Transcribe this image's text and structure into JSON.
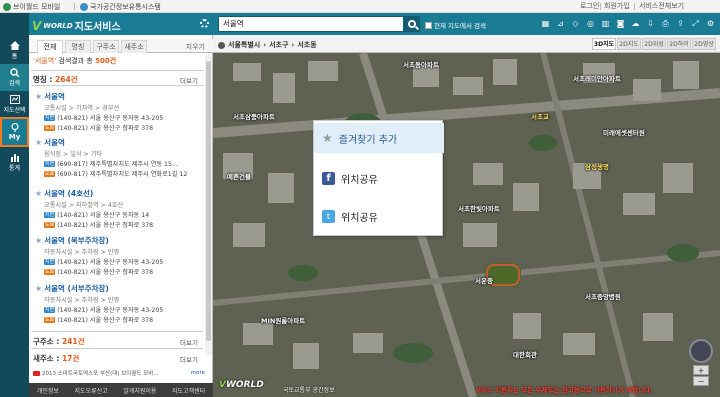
{
  "topbar": {
    "links_left": [
      "브이월드 모바일",
      "국가공간정보유통시스템"
    ],
    "links_right": [
      "로그인",
      "회원가입",
      "서비스전체보기"
    ]
  },
  "leftnav": {
    "items": [
      {
        "label": "홈",
        "icon": "home-icon"
      },
      {
        "label": "검색",
        "icon": "search-icon"
      },
      {
        "label": "지도선택",
        "icon": "map-select-icon"
      },
      {
        "label": "My",
        "icon": "pin-icon"
      },
      {
        "label": "통계",
        "icon": "stats-icon"
      }
    ]
  },
  "panel": {
    "title": "지도서비스",
    "tabs": [
      "전체",
      "명칭",
      "구주소",
      "새주소"
    ],
    "clear_label": "지우기",
    "summary": {
      "keyword": "'서울역'",
      "text": "검색결과 총",
      "count": "500건"
    },
    "sections": {
      "name": {
        "title": "명칭",
        "count": "264건",
        "more": "더보기"
      },
      "old_address": {
        "title": "구주소",
        "count": "241건",
        "more": "더보기"
      },
      "new_address": {
        "title": "새주소",
        "count": "17건",
        "more": "더보기"
      }
    },
    "results": [
      {
        "name": "서울역",
        "category": "교통시설 > 기차역 > 경부선",
        "jibun": "(140-821) 서울 용산구 동자동 43-205",
        "road": "(140-821) 서울 용산구 청파로 378"
      },
      {
        "name": "서울역",
        "category": "음식점 > 일식 > 기타",
        "jibun": "(690-817) 제주특별자치도 제주시 연동 15...",
        "road": "(690-817) 제주특별자치도 제주시 연화로1길 12"
      },
      {
        "name": "서울역 (4호선)",
        "category": "교통시설 > 지하철역 > 4호선",
        "jibun": "(140-821) 서울 용산구 동자동 14",
        "road": "(140-821) 서울 용산구 청파로 378"
      },
      {
        "name": "서울역 (북부주차장)",
        "category": "자동차시설 > 주차장 > 민영",
        "jibun": "(140-821) 서울 용산구 동자동 43-205",
        "road": "(140-821) 서울 용산구 청파로 378"
      },
      {
        "name": "서울역 (서부주차장)",
        "category": "자동차시설 > 주차장 > 민영",
        "jibun": "(140-821) 서울 용산구 동자동 43-205",
        "road": "(140-821) 서울 용산구 청파로 378"
      }
    ],
    "badges": {
      "jibun": "지번",
      "road": "도로"
    },
    "ad": {
      "text": "2013 스마트국토엑스포 부산(대) 브이월드 모바...",
      "more": "more"
    },
    "footer": [
      "개인정보",
      "지도오류신고",
      "알게지원이용",
      "지도고객센터"
    ]
  },
  "map": {
    "search_value": "서울역",
    "scope_checkbox_label": "현재 지도에서 검색",
    "location": [
      "서울특별시",
      "서초구",
      "서초동"
    ],
    "view_modes": [
      "3D지도",
      "2D지도",
      "2D위성",
      "2D하이",
      "2D영상"
    ],
    "active_mode": "3D지도",
    "labels": [
      {
        "text": "서초동아파트",
        "y": false
      },
      {
        "text": "서초래미안아파트",
        "y": false
      },
      {
        "text": "서초삼풍아파트",
        "y": false
      },
      {
        "text": "서초교",
        "y": true
      },
      {
        "text": "미래에셋센터원",
        "y": false
      },
      {
        "text": "예쁜건물",
        "y": false
      },
      {
        "text": "서초한빛아파트",
        "y": false
      },
      {
        "text": "삼성생명",
        "y": true
      },
      {
        "text": "서운중",
        "y": false
      },
      {
        "text": "서초중앙병원",
        "y": false
      },
      {
        "text": "MIN원룸아파트",
        "y": false
      },
      {
        "text": "대한회관",
        "y": false
      }
    ],
    "popup": {
      "favorite": "즐겨찾기 추가",
      "share_facebook": "위치공유",
      "share_twitter": "위치공유"
    },
    "logo": "WORLD",
    "footer_links": "국토교통부 공간정보",
    "notice": "서비스 지원되는 모든 주제도는 참고용으로 사용하시기 바랍니다."
  },
  "colors": {
    "brand": "#197b94",
    "nav_dark": "#124a5b",
    "accent": "#e05a1a",
    "link": "#1c5ea8"
  }
}
